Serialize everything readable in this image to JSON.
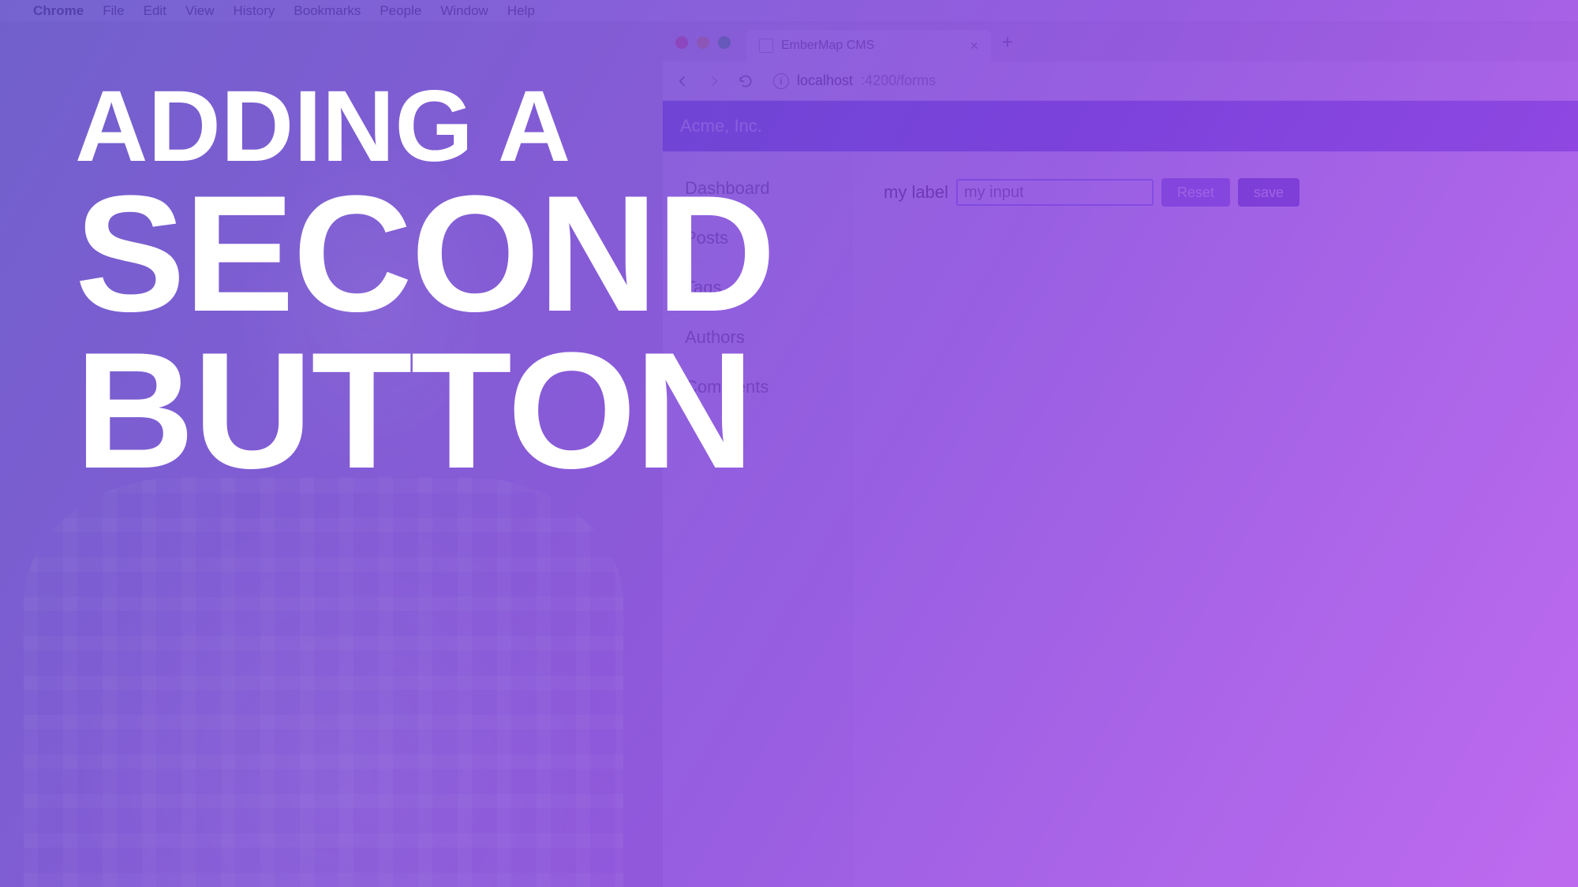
{
  "title": {
    "line1": "ADDING A",
    "line2": "SECOND",
    "line3": "BUTTON"
  },
  "mac_menubar": {
    "app": "Chrome",
    "items": [
      "File",
      "Edit",
      "View",
      "History",
      "Bookmarks",
      "People",
      "Window",
      "Help"
    ]
  },
  "chrome": {
    "tab_title": "EmberMap CMS",
    "new_tab_glyph": "+",
    "close_glyph": "×",
    "url_host": "localhost",
    "url_port_path": ":4200/forms"
  },
  "app": {
    "header_title": "Acme, Inc.",
    "sidebar": {
      "items": [
        "Dashboard",
        "Posts",
        "Tags",
        "Authors",
        "Comments"
      ]
    },
    "form": {
      "label": "my label",
      "input_value": "my input",
      "reset_label": "Reset",
      "save_label": "save"
    }
  },
  "colors": {
    "overlay_from": "#5a46c8",
    "overlay_to": "#af46eb",
    "header_bg": "#5d5ed6",
    "btn_primary": "#3c3db3",
    "btn_secondary": "#6b67e0"
  }
}
